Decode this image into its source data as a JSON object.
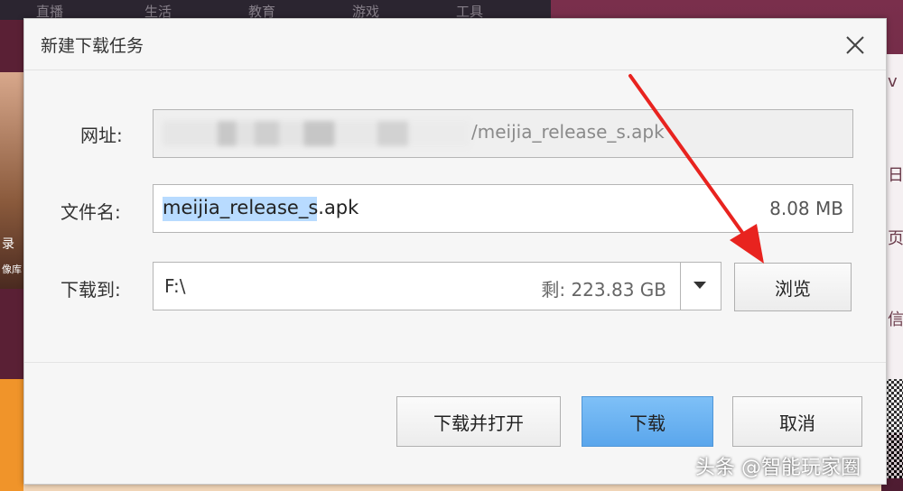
{
  "background": {
    "nav_items": [
      "直播",
      "生活",
      "教育",
      "游戏",
      "工具"
    ],
    "left_strip_text": [
      "录",
      "像库"
    ],
    "right_strip_text": [
      "​v",
      "日",
      "页",
      "信"
    ]
  },
  "dialog": {
    "title": "新建下载任务",
    "url": {
      "label": "网址:",
      "visible_value": "/meijia_release_s.apk"
    },
    "filename": {
      "label": "文件名:",
      "value": "meijia_release_s.apk",
      "size": "8.08 MB"
    },
    "destination": {
      "label": "下载到:",
      "path": "F:\\",
      "free_space": "剩: 223.83 GB"
    },
    "buttons": {
      "browse": "浏览",
      "download_and_open": "下载并打开",
      "download": "下载",
      "cancel": "取消"
    }
  },
  "watermark": "头条 @智能玩家圈",
  "colors": {
    "primary_button": "#5aa6ec",
    "annotation_arrow": "#e8231f",
    "selection": "#3399ff"
  }
}
